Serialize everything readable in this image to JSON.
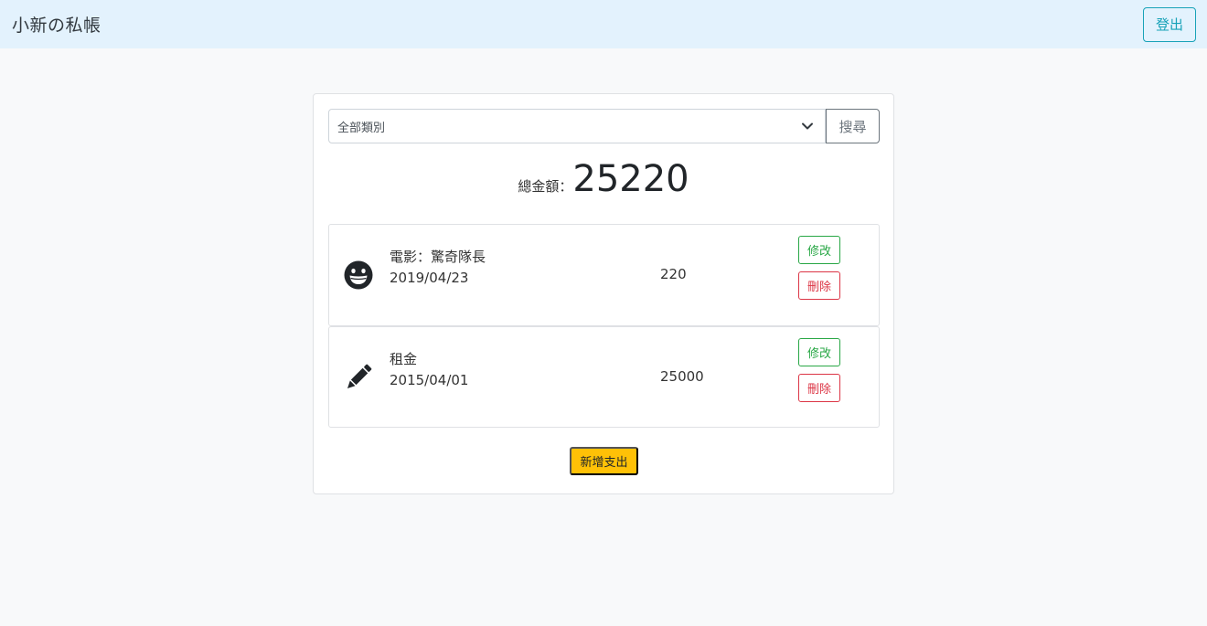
{
  "navbar": {
    "brand": "小新の私帳",
    "logout_label": "登出",
    "logout_color": "#17a2b8"
  },
  "filter": {
    "selected_category": "全部類別",
    "search_label": "搜尋"
  },
  "summary": {
    "total_label": "總金額：",
    "total_value": "25220"
  },
  "expenses": [
    {
      "icon": "grin-icon",
      "title": "電影：驚奇隊長",
      "date": "2019/04/23",
      "amount": "220",
      "edit_label": "修改",
      "delete_label": "刪除"
    },
    {
      "icon": "pencil-icon",
      "title": "租金",
      "date": "2015/04/01",
      "amount": "25000",
      "edit_label": "修改",
      "delete_label": "刪除"
    }
  ],
  "actions": {
    "add_expense_label": "新增支出",
    "add_color": "#ffc107"
  }
}
